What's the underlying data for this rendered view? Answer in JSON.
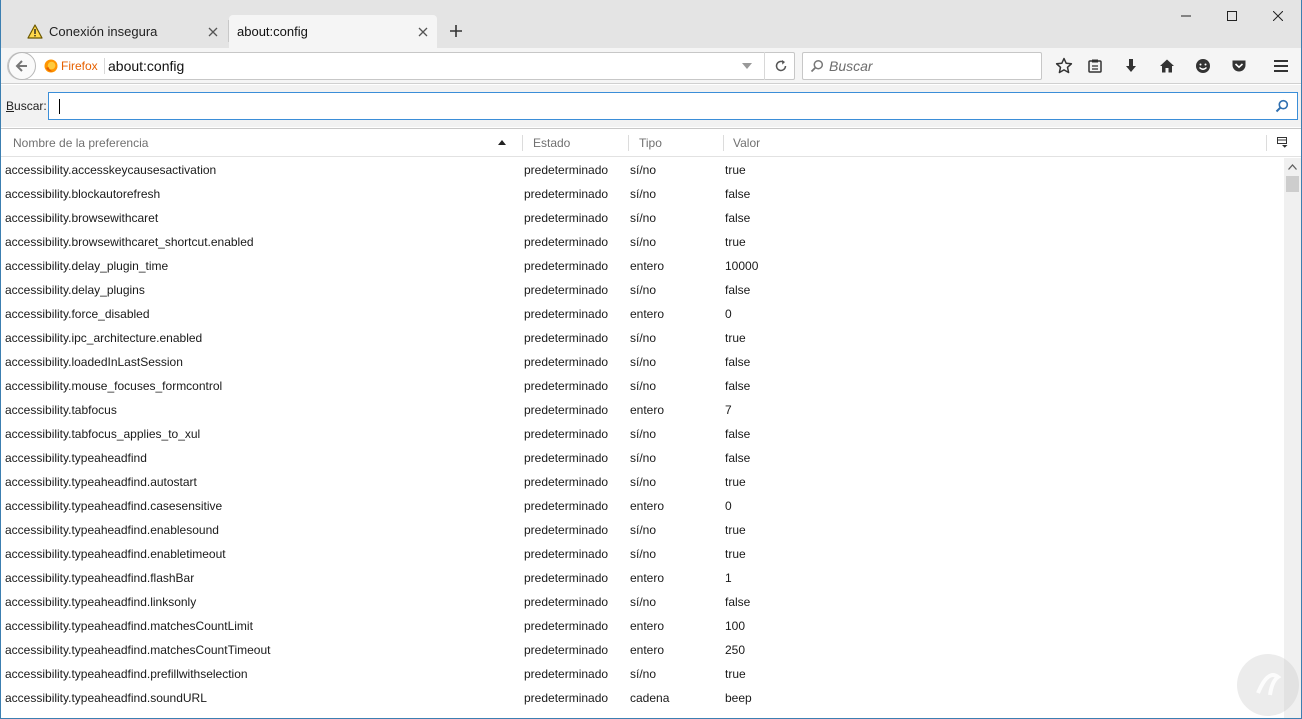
{
  "tabs": [
    {
      "label": "Conexión insegura",
      "active": false,
      "icon": "warning-icon"
    },
    {
      "label": "about:config",
      "active": true
    }
  ],
  "navbar": {
    "identity_label": "Firefox",
    "url": "about:config",
    "search_placeholder": "Buscar"
  },
  "config_search": {
    "label_accel": "B",
    "label_rest": "uscar:",
    "value": ""
  },
  "columns": {
    "name": "Nombre de la preferencia",
    "state": "Estado",
    "type": "Tipo",
    "value": "Valor"
  },
  "rows": [
    {
      "name": "accessibility.accesskeycausesactivation",
      "state": "predeterminado",
      "type": "sí/no",
      "value": "true"
    },
    {
      "name": "accessibility.blockautorefresh",
      "state": "predeterminado",
      "type": "sí/no",
      "value": "false"
    },
    {
      "name": "accessibility.browsewithcaret",
      "state": "predeterminado",
      "type": "sí/no",
      "value": "false"
    },
    {
      "name": "accessibility.browsewithcaret_shortcut.enabled",
      "state": "predeterminado",
      "type": "sí/no",
      "value": "true"
    },
    {
      "name": "accessibility.delay_plugin_time",
      "state": "predeterminado",
      "type": "entero",
      "value": "10000"
    },
    {
      "name": "accessibility.delay_plugins",
      "state": "predeterminado",
      "type": "sí/no",
      "value": "false"
    },
    {
      "name": "accessibility.force_disabled",
      "state": "predeterminado",
      "type": "entero",
      "value": "0"
    },
    {
      "name": "accessibility.ipc_architecture.enabled",
      "state": "predeterminado",
      "type": "sí/no",
      "value": "true"
    },
    {
      "name": "accessibility.loadedInLastSession",
      "state": "predeterminado",
      "type": "sí/no",
      "value": "false"
    },
    {
      "name": "accessibility.mouse_focuses_formcontrol",
      "state": "predeterminado",
      "type": "sí/no",
      "value": "false"
    },
    {
      "name": "accessibility.tabfocus",
      "state": "predeterminado",
      "type": "entero",
      "value": "7"
    },
    {
      "name": "accessibility.tabfocus_applies_to_xul",
      "state": "predeterminado",
      "type": "sí/no",
      "value": "false"
    },
    {
      "name": "accessibility.typeaheadfind",
      "state": "predeterminado",
      "type": "sí/no",
      "value": "false"
    },
    {
      "name": "accessibility.typeaheadfind.autostart",
      "state": "predeterminado",
      "type": "sí/no",
      "value": "true"
    },
    {
      "name": "accessibility.typeaheadfind.casesensitive",
      "state": "predeterminado",
      "type": "entero",
      "value": "0"
    },
    {
      "name": "accessibility.typeaheadfind.enablesound",
      "state": "predeterminado",
      "type": "sí/no",
      "value": "true"
    },
    {
      "name": "accessibility.typeaheadfind.enabletimeout",
      "state": "predeterminado",
      "type": "sí/no",
      "value": "true"
    },
    {
      "name": "accessibility.typeaheadfind.flashBar",
      "state": "predeterminado",
      "type": "entero",
      "value": "1"
    },
    {
      "name": "accessibility.typeaheadfind.linksonly",
      "state": "predeterminado",
      "type": "sí/no",
      "value": "false"
    },
    {
      "name": "accessibility.typeaheadfind.matchesCountLimit",
      "state": "predeterminado",
      "type": "entero",
      "value": "100"
    },
    {
      "name": "accessibility.typeaheadfind.matchesCountTimeout",
      "state": "predeterminado",
      "type": "entero",
      "value": "250"
    },
    {
      "name": "accessibility.typeaheadfind.prefillwithselection",
      "state": "predeterminado",
      "type": "sí/no",
      "value": "true"
    },
    {
      "name": "accessibility.typeaheadfind.soundURL",
      "state": "predeterminado",
      "type": "cadena",
      "value": "beep"
    }
  ],
  "colors": {
    "accent": "#3b8ed8",
    "firefox_label": "#e66000",
    "tabstrip_bg": "#e4e4e4"
  }
}
